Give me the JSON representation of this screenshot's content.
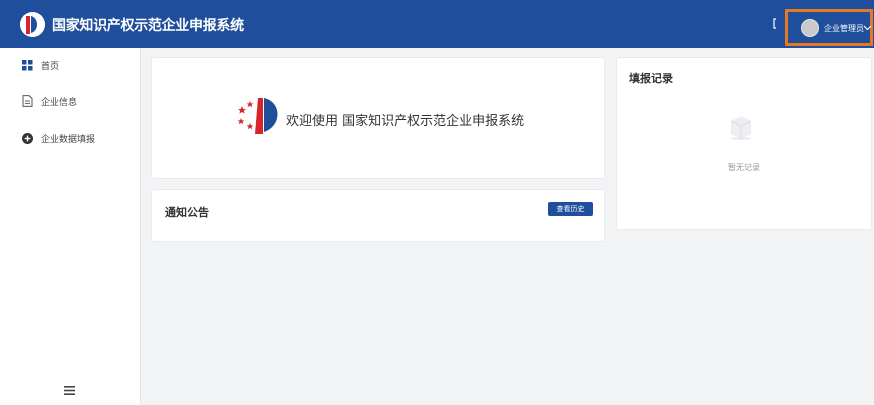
{
  "header": {
    "app_title": "国家知识产权示范企业申报系统",
    "user_name": "企业管理员",
    "brand_color": "#1f4f9c",
    "highlight_color": "#e87722"
  },
  "sidebar": {
    "items": [
      {
        "label": "首页",
        "icon": "grid-icon"
      },
      {
        "label": "企业信息",
        "icon": "document-icon"
      },
      {
        "label": "企业数据填报",
        "icon": "plus-circle-icon"
      }
    ],
    "collapse_icon": "menu-icon"
  },
  "welcome": {
    "text": "欢迎使用 国家知识产权示范企业申报系统"
  },
  "notice": {
    "title": "通知公告",
    "history_button": "查看历史"
  },
  "records": {
    "title": "填报记录",
    "empty_text": "暂无记录"
  }
}
